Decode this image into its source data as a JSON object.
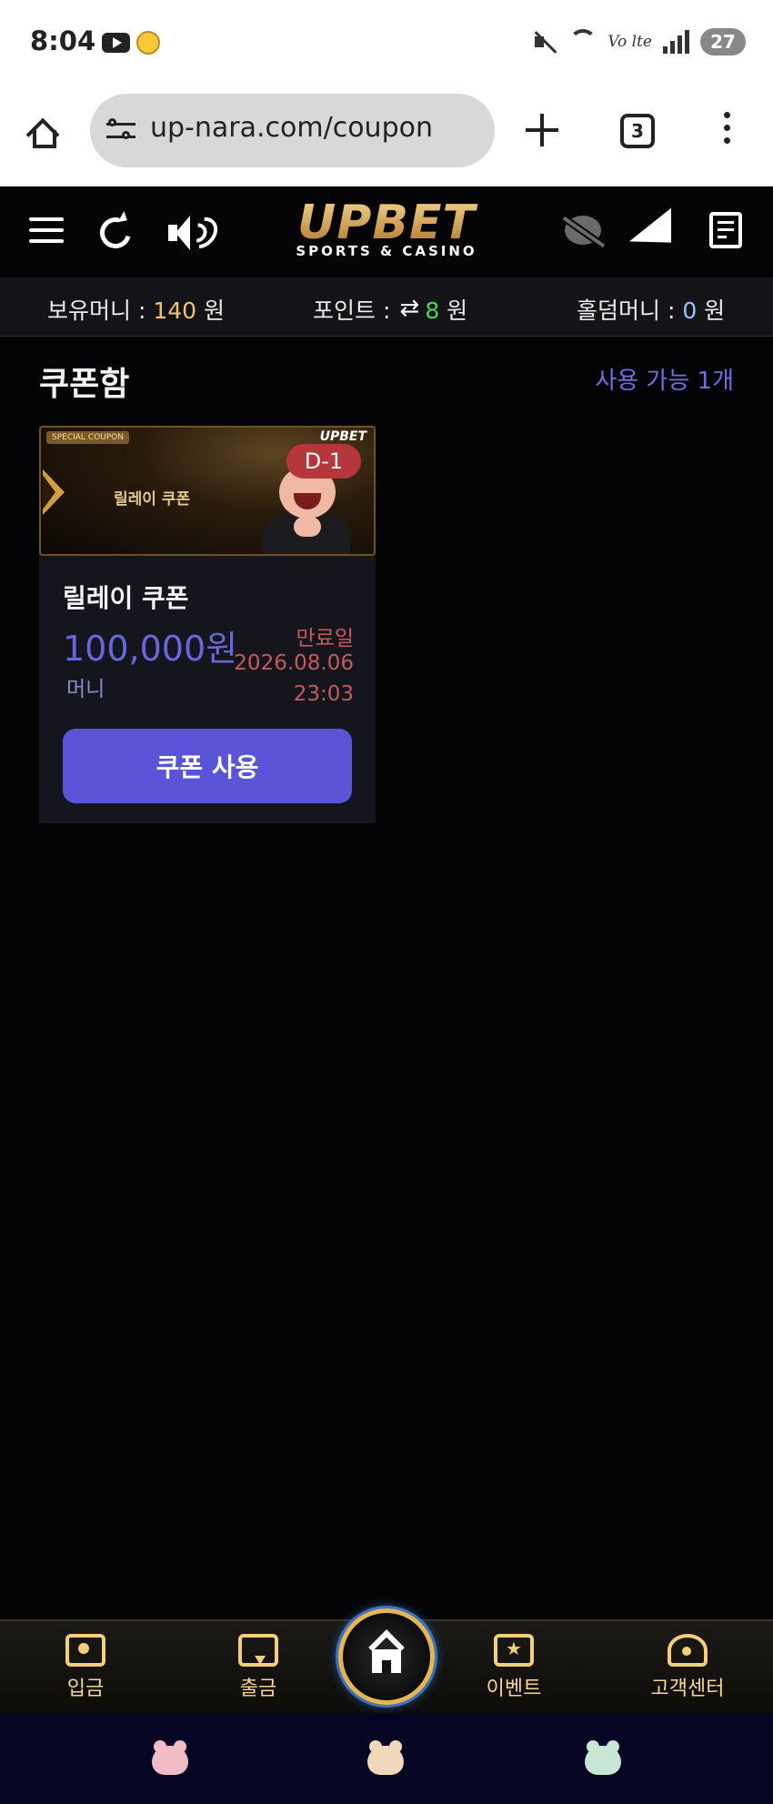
{
  "status_bar": {
    "time": "8:04",
    "battery": "27",
    "network": "Vo lte"
  },
  "browser": {
    "url": "up-nara.com/coupon",
    "tab_count": "3"
  },
  "header": {
    "logo_main": "UPBET",
    "logo_sub": "SPORTS & CASINO"
  },
  "balance": {
    "money_label": "보유머니 : ",
    "money_value": "140",
    "money_unit": " 원",
    "point_label": "포인트 : ",
    "point_value": "8",
    "point_unit": " 원",
    "holdem_label": "홀덤머니 : ",
    "holdem_value": "0",
    "holdem_unit": " 원"
  },
  "coupon_box": {
    "title": "쿠폰함",
    "available": "사용 가능 1개",
    "coupons": [
      {
        "banner_tag": "SPECIAL COUPON",
        "banner_text": "릴레이 쿠폰",
        "banner_logo": "UPBET",
        "dday": "D-1",
        "name": "릴레이 쿠폰",
        "amount": "100,000원",
        "type": "머니",
        "expire_label": "만료일",
        "expire_date": "2026.08.06",
        "expire_time": "23:03",
        "use_label": "쿠폰 사용"
      }
    ]
  },
  "bottom_nav": {
    "deposit": "입금",
    "withdraw": "출금",
    "event": "이벤트",
    "support": "고객센터"
  },
  "colors": {
    "accent": "#5a55d8",
    "gold": "#f3cf79",
    "expire": "#c45a5c",
    "background": "#040406"
  }
}
